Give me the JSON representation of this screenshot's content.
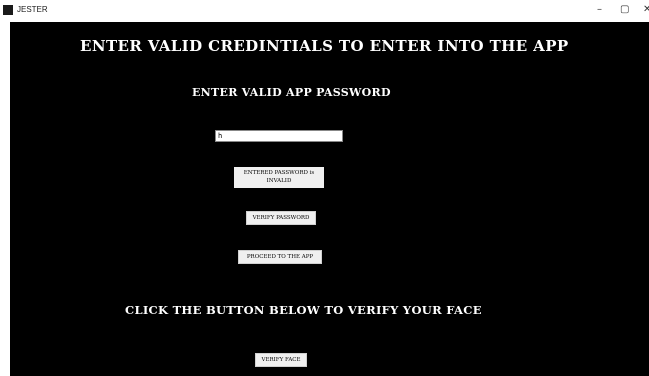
{
  "window": {
    "title": "JESTER",
    "controls": {
      "minimize": "–",
      "maximize": "▢",
      "close": "✕"
    }
  },
  "main": {
    "heading": "ENTER VALID CREDINTIALS TO ENTER INTO THE APP",
    "password_heading": "ENTER VALID APP PASSWORD",
    "password_value": "h",
    "status_text": "ENTERED PASSWORD is INVALID",
    "verify_password_label": "VERIFY PASSWORD",
    "proceed_label": "PROCEED TO THE APP",
    "face_heading": "CLICK THE BUTTON BELOW TO VERIFY YOUR FACE",
    "verify_face_label": "VERIFY FACE"
  },
  "colors": {
    "canvas_background": "#000000",
    "text": "#ffffff",
    "button_background": "#f0f0f0"
  }
}
